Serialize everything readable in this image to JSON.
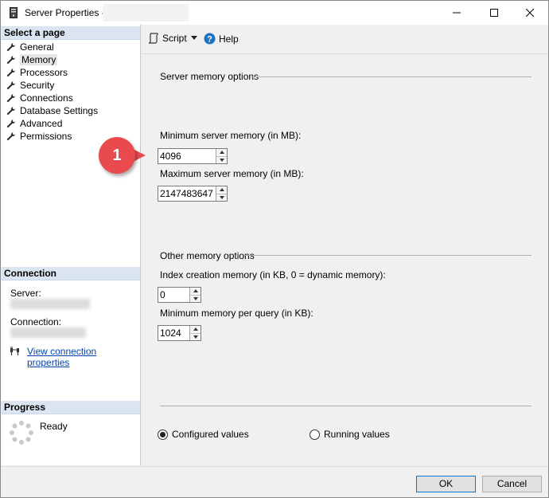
{
  "window": {
    "title": "Server Properties -"
  },
  "left_panel": {
    "select_page_header": "Select a page",
    "pages": [
      {
        "label": "General",
        "selected": false
      },
      {
        "label": "Memory",
        "selected": true
      },
      {
        "label": "Processors",
        "selected": false
      },
      {
        "label": "Security",
        "selected": false
      },
      {
        "label": "Connections",
        "selected": false
      },
      {
        "label": "Database Settings",
        "selected": false
      },
      {
        "label": "Advanced",
        "selected": false
      },
      {
        "label": "Permissions",
        "selected": false
      }
    ],
    "connection_header": "Connection",
    "server_label": "Server:",
    "connection_label": "Connection:",
    "view_connection_link": "View connection properties",
    "progress_header": "Progress",
    "progress_status": "Ready"
  },
  "toolbar": {
    "script_label": "Script",
    "help_label": "Help"
  },
  "memory": {
    "server_memory_group": "Server memory options",
    "min_label": "Minimum server memory (in MB):",
    "min_value": "4096",
    "max_label": "Maximum server memory (in MB):",
    "max_value": "2147483647",
    "other_group": "Other memory options",
    "index_label": "Index creation memory (in KB, 0 = dynamic memory):",
    "index_value": "0",
    "query_label": "Minimum memory per query (in KB):",
    "query_value": "1024",
    "radio_configured": "Configured values",
    "radio_running": "Running values",
    "selected_radio": "configured"
  },
  "callout": {
    "number": "1",
    "color": "#e84a4d"
  },
  "footer": {
    "ok_label": "OK",
    "cancel_label": "Cancel"
  },
  "colors": {
    "section_header_bg": "#dbe5f1",
    "link": "#0645ad",
    "ok_border": "#0078d7"
  }
}
